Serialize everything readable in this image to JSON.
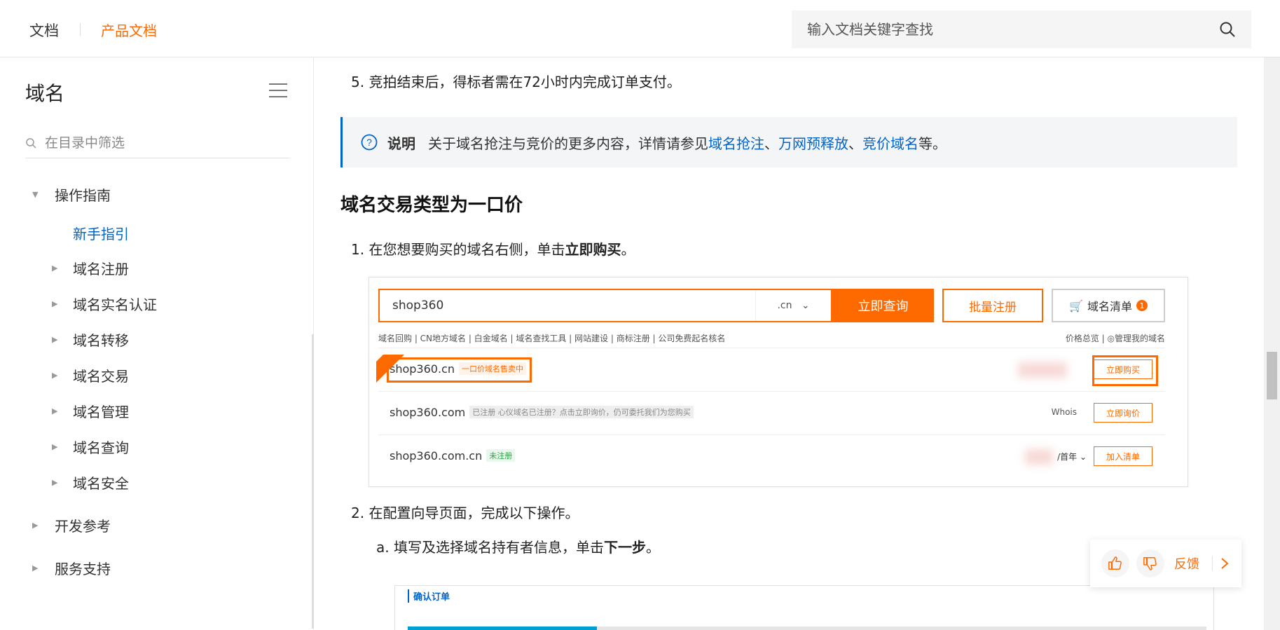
{
  "header": {
    "doc_label": "文档",
    "product_label": "产品文档",
    "search_placeholder": "输入文档关键字查找",
    "accent": "#ff6a00"
  },
  "sidebar": {
    "title": "域名",
    "filter_placeholder": "在目录中筛选",
    "section": "操作指南",
    "items": [
      {
        "label": "新手指引",
        "active": true
      },
      {
        "label": "域名注册"
      },
      {
        "label": "域名实名认证"
      },
      {
        "label": "域名转移"
      },
      {
        "label": "域名交易"
      },
      {
        "label": "域名管理"
      },
      {
        "label": "域名查询"
      },
      {
        "label": "域名安全"
      }
    ],
    "bottom": [
      "开发参考",
      "服务支持"
    ]
  },
  "content": {
    "step5": "5. 竞拍结束后，得标者需在72小时内完成订单支付。",
    "note_label": "说明",
    "note_prefix": "关于域名抢注与竞价的更多内容，详情请参见",
    "note_link1": "域名抢注",
    "note_sep1": "、",
    "note_link2": "万网预释放",
    "note_sep2": "、",
    "note_link3": "竞价域名",
    "note_suffix": "等。",
    "heading": "域名交易类型为一口价",
    "step1_prefix": "1. 在您想要购买的域名右侧，单击",
    "step1_bold": "立即购买",
    "step1_suffix": "。",
    "step2": "2. 在配置向导页面，完成以下操作。",
    "step2a_prefix": "a. 填写及选择域名持有者信息，单击",
    "step2a_bold": "下一步",
    "step2a_suffix": "。"
  },
  "shot1": {
    "input_value": "shop360",
    "ext": ".cn",
    "query_btn": "立即查询",
    "batch_btn": "批量注册",
    "cart_btn": "域名清单",
    "cart_count": "1",
    "links": "域名回购 | CN地方域名 | 白金域名 | 域名查找工具 | 网站建设 | 商标注册 | 公司免费起名核名",
    "right_links_a": "价格总览",
    "right_links_b": "管理我的域名",
    "rows": [
      {
        "name": "shop360.cn",
        "tag": "一口价域名售卖中",
        "action": "立即购买"
      },
      {
        "name": "shop360.com",
        "tag": "已注册 心仪域名已注册？点击立即询价，仍可委托我们为您购买",
        "extra": "Whois",
        "action": "立即询价"
      },
      {
        "name": "shop360.com.cn",
        "tag": "未注册",
        "extra": "/首年",
        "action": "加入清单"
      }
    ]
  },
  "shot2": {
    "title": "确认订单"
  },
  "feedback": {
    "label": "反馈"
  }
}
